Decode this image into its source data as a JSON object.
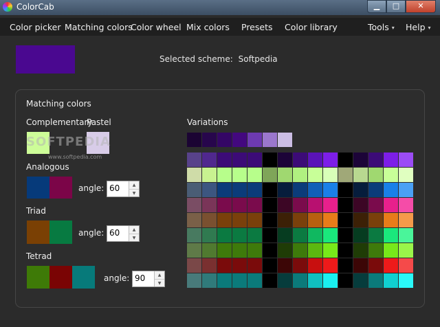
{
  "window": {
    "title": "ColorCab",
    "icon": "color-wheel-icon",
    "controls": {
      "minimize": "▁",
      "maximize": "□",
      "close": "✕"
    }
  },
  "menu": {
    "items": [
      "Color picker",
      "Matching colors",
      "Color wheel",
      "Mix colors",
      "Presets",
      "Color library"
    ],
    "tools": "Tools",
    "help": "Help",
    "caret": "▾"
  },
  "selected": {
    "color": "#4a0890",
    "label": "Selected scheme:",
    "value": "Softpedia"
  },
  "panel": {
    "title": "Matching colors",
    "complementary": {
      "label": "Complementary",
      "color": "#cdfd98"
    },
    "pastel": {
      "label": "Pastel",
      "color": "#d8cce8"
    },
    "analogous": {
      "label": "Analogous",
      "colors": [
        "#063a7a",
        "#7b0548"
      ],
      "angle_label": "angle:",
      "angle": "60"
    },
    "triad": {
      "label": "Triad",
      "colors": [
        "#7a4004",
        "#077a41"
      ],
      "angle_label": "angle:",
      "angle": "60"
    },
    "tetrad": {
      "label": "Tetrad",
      "colors": [
        "#3e7a07",
        "#7a0404",
        "#077a7a"
      ],
      "angle_label": "angle:",
      "angle": "90"
    },
    "variations": {
      "label": "Variations",
      "strip": [
        "#1b0433",
        "#27064c",
        "#340665",
        "#43087f",
        "#6d3ab1",
        "#9b77cd",
        "#cbbde4"
      ],
      "grid": [
        [
          "#58428a",
          "#50288e",
          "#3c0b77",
          "#3c0b77",
          "#3c0b77",
          "#000000",
          "#1c0438",
          "#3c0b77",
          "#5a13b8",
          "#7d1ee8",
          "#000000",
          "#1c0438",
          "#3c0b77",
          "#7d1ee8",
          "#9b4cf5"
        ],
        [
          "#cfdca8",
          "#c8f290",
          "#b7fe8b",
          "#b7fe8b",
          "#b7fe8b",
          "#7fa559",
          "#a0d870",
          "#b0f080",
          "#c8ff98",
          "#d8ffb8",
          "#a0a878",
          "#b8d890",
          "#a0d870",
          "#c8ff98",
          "#e0ffc0"
        ],
        [
          "#4a5d75",
          "#3c5680",
          "#0b3c7a",
          "#0b3c7a",
          "#0b3c7a",
          "#000000",
          "#061d3c",
          "#0b3c7a",
          "#1060b8",
          "#1a80e8",
          "#000000",
          "#061d3c",
          "#0b3c7a",
          "#1a80e8",
          "#4aa0f5"
        ],
        [
          "#7a4d64",
          "#7a3558",
          "#7a0b4c",
          "#7a0b4c",
          "#7a0b4c",
          "#000000",
          "#3c0625",
          "#7a0b4c",
          "#b81070",
          "#e8208c",
          "#000000",
          "#3c0625",
          "#7a0b4c",
          "#e8208c",
          "#f54ca8"
        ],
        [
          "#7a6048",
          "#7a5030",
          "#7a400b",
          "#7a400b",
          "#7a400b",
          "#000000",
          "#3c2006",
          "#7a400b",
          "#b86010",
          "#e87c1a",
          "#000000",
          "#3c2006",
          "#7a400b",
          "#e87c1a",
          "#f59a4a"
        ],
        [
          "#487a60",
          "#307a50",
          "#0b7a41",
          "#0b7a41",
          "#0b7a41",
          "#000000",
          "#063c20",
          "#0b7a41",
          "#10b860",
          "#1ae87c",
          "#000000",
          "#063c20",
          "#0b7a41",
          "#1ae87c",
          "#4af59a"
        ],
        [
          "#5f7a48",
          "#507a30",
          "#3e7a0b",
          "#3e7a0b",
          "#3e7a0b",
          "#000000",
          "#1f3c06",
          "#3e7a0b",
          "#5cb810",
          "#78e81a",
          "#000000",
          "#1f3c06",
          "#3e7a0b",
          "#78e81a",
          "#9af54a"
        ],
        [
          "#7a4848",
          "#7a3030",
          "#7a0b0b",
          "#7a0b0b",
          "#7a0b0b",
          "#000000",
          "#3c0606",
          "#7a0b0b",
          "#c80f0f",
          "#ee1a1a",
          "#000000",
          "#3c0606",
          "#7a0b0b",
          "#ee1a1a",
          "#f54a4a"
        ],
        [
          "#487a7a",
          "#307a7a",
          "#0b7a7a",
          "#0b7a7a",
          "#0b7a7a",
          "#000000",
          "#063c3c",
          "#0b7a7a",
          "#10c0c0",
          "#1af0f0",
          "#000000",
          "#063c3c",
          "#0b7a7a",
          "#10d0d0",
          "#2af8f8"
        ]
      ]
    }
  },
  "watermark": {
    "big": "SOFTPEDIA",
    "small": "www.softpedia.com"
  }
}
